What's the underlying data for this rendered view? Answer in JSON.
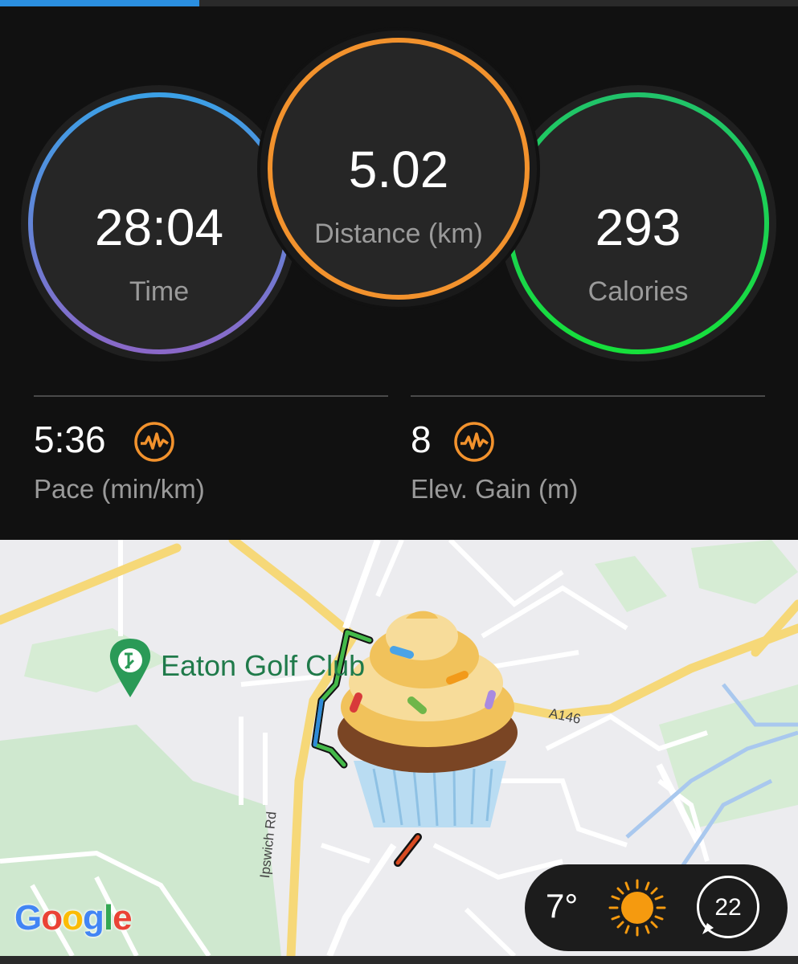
{
  "progress": {
    "fraction": 0.25,
    "color": "#2b8fe0"
  },
  "rings": {
    "time": {
      "value": "28:04",
      "label": "Time"
    },
    "distance": {
      "value": "5.02",
      "label": "Distance (km)"
    },
    "calories": {
      "value": "293",
      "label": "Calories"
    }
  },
  "metrics": {
    "pace": {
      "value": "5:36",
      "label": "Pace (min/km)",
      "icon": "activity-wave-icon"
    },
    "elevation": {
      "value": "8",
      "label": "Elev. Gain (m)",
      "icon": "activity-wave-icon"
    }
  },
  "map": {
    "place_label": "Eaton Golf Club",
    "road_a146": "A146",
    "road_ipswich": "Ipswich Rd",
    "attribution": [
      "G",
      "o",
      "o",
      "g",
      "l",
      "e"
    ],
    "attribution_colors": [
      "#4285F4",
      "#EA4335",
      "#FBBC05",
      "#4285F4",
      "#34A853",
      "#EA4335"
    ]
  },
  "weather": {
    "temperature": "7°",
    "condition_icon": "sun-icon",
    "wind": "22"
  },
  "colors": {
    "time_ring_start": "#3ba0e6",
    "time_ring_end": "#8a68c8",
    "distance_ring": "#f2922d",
    "calories_ring_start": "#21c36a",
    "calories_ring_end": "#16e03b",
    "icon_orange": "#f2922d"
  }
}
